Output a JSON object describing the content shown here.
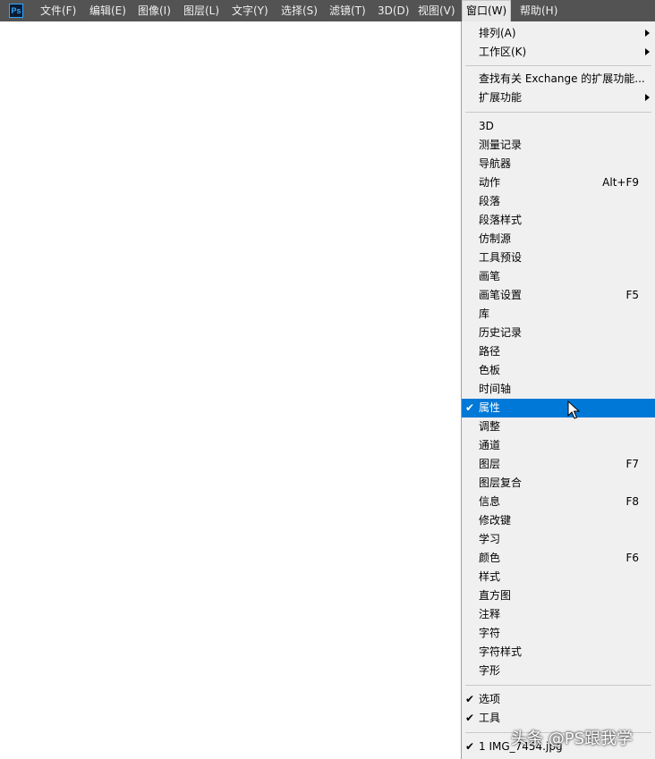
{
  "menubar": {
    "logo": "Ps",
    "items": [
      "文件(F)",
      "编辑(E)",
      "图像(I)",
      "图层(L)",
      "文字(Y)",
      "选择(S)",
      "滤镜(T)",
      "3D(D)",
      "视图(V)",
      "窗口(W)",
      "帮助(H)"
    ],
    "active_item": "窗口(W)"
  },
  "window_menu": {
    "group1": [
      {
        "label": "排列(A)",
        "submenu": true
      },
      {
        "label": "工作区(K)",
        "submenu": true
      }
    ],
    "group2": [
      {
        "label": "查找有关 Exchange 的扩展功能..."
      },
      {
        "label": "扩展功能",
        "submenu": true
      }
    ],
    "group3": [
      {
        "label": "3D"
      },
      {
        "label": "测量记录"
      },
      {
        "label": "导航器"
      },
      {
        "label": "动作",
        "shortcut": "Alt+F9"
      },
      {
        "label": "段落"
      },
      {
        "label": "段落样式"
      },
      {
        "label": "仿制源"
      },
      {
        "label": "工具预设"
      },
      {
        "label": "画笔"
      },
      {
        "label": "画笔设置",
        "shortcut": "F5"
      },
      {
        "label": "库"
      },
      {
        "label": "历史记录"
      },
      {
        "label": "路径"
      },
      {
        "label": "色板"
      },
      {
        "label": "时间轴"
      },
      {
        "label": "属性",
        "checked": true,
        "highlighted": true
      },
      {
        "label": "调整"
      },
      {
        "label": "通道"
      },
      {
        "label": "图层",
        "shortcut": "F7"
      },
      {
        "label": "图层复合"
      },
      {
        "label": "信息",
        "shortcut": "F8"
      },
      {
        "label": "修改键"
      },
      {
        "label": "学习"
      },
      {
        "label": "颜色",
        "shortcut": "F6"
      },
      {
        "label": "样式"
      },
      {
        "label": "直方图"
      },
      {
        "label": "注释"
      },
      {
        "label": "字符"
      },
      {
        "label": "字符样式"
      },
      {
        "label": "字形"
      }
    ],
    "group4": [
      {
        "label": "选项",
        "checked": true
      },
      {
        "label": "工具",
        "checked": true
      }
    ],
    "group5": [
      {
        "label": "1 IMG_7454.jpg",
        "checked": true
      }
    ]
  },
  "watermark": "头条 @PS跟我学",
  "colors": {
    "menubar_bg": "#535353",
    "menu_bg": "#f0f0f0",
    "highlight": "#0078d7"
  }
}
